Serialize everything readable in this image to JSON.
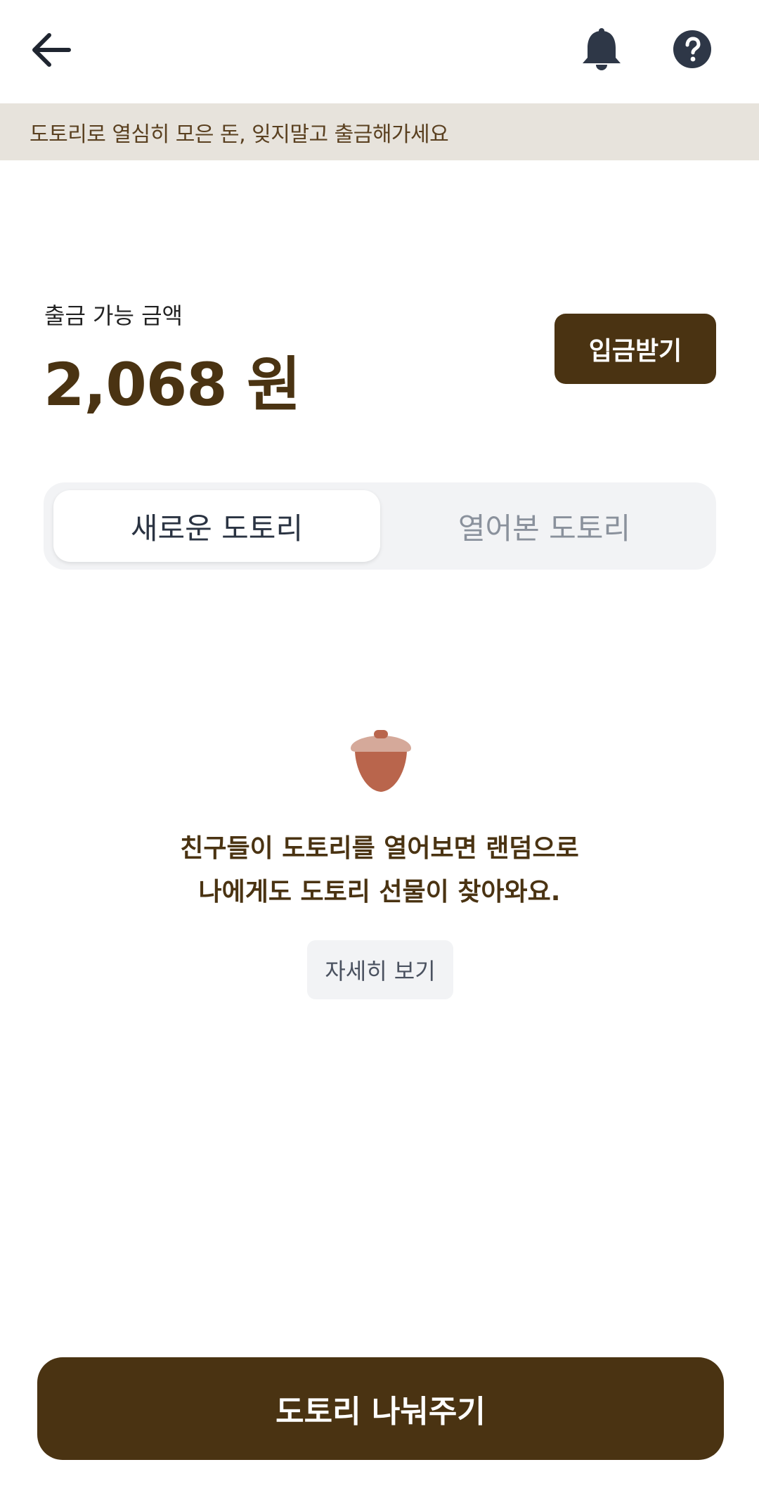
{
  "header": {
    "back_icon": "arrow-left-icon",
    "notification_icon": "bell-icon",
    "help_icon": "question-circle-icon"
  },
  "notice": {
    "text": "도토리로 열심히 모은 돈, 잊지말고 출금해가세요"
  },
  "balance": {
    "label": "출금 가능 금액",
    "amount": "2,068 원",
    "deposit_button": "입금받기"
  },
  "tabs": [
    {
      "label": "새로운 도토리",
      "selected": true
    },
    {
      "label": "열어본 도토리",
      "selected": false
    }
  ],
  "empty_state": {
    "icon": "acorn-icon",
    "message_line1": "친구들이 도토리를 열어보면 랜덤으로",
    "message_line2": "나에게도 도토리 선물이 찾아와요.",
    "detail_button": "자세히 보기"
  },
  "cta": {
    "share_button": "도토리 나눠주기"
  },
  "colors": {
    "brand_brown": "#4a3312",
    "notice_bg": "#e7e3dc",
    "acorn_cap": "#d5a99a",
    "acorn_body": "#b9654c"
  }
}
